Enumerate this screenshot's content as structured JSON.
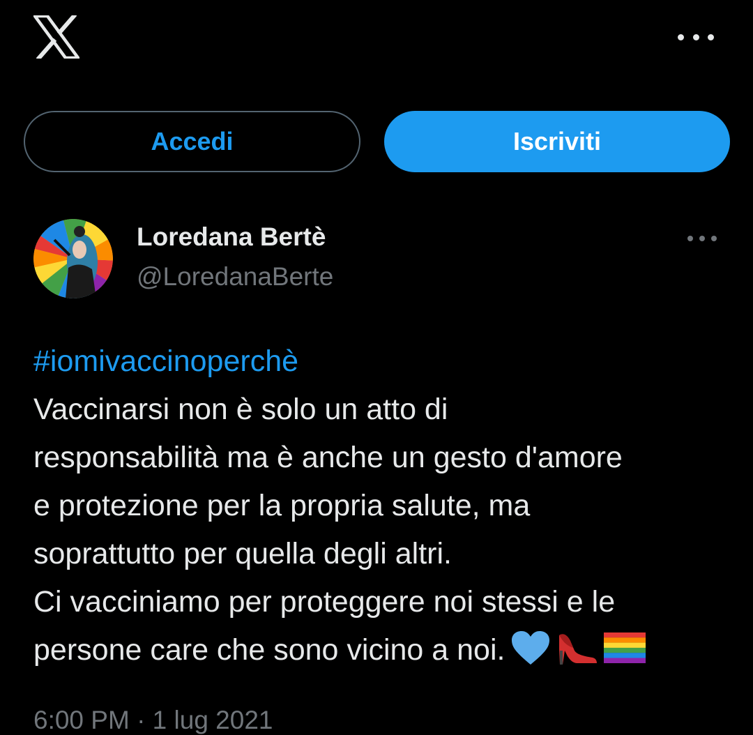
{
  "header": {
    "logo_icon": "x-logo-icon",
    "more_icon": "more-horizontal-icon"
  },
  "auth": {
    "login_label": "Accedi",
    "signup_label": "Iscriviti"
  },
  "tweet": {
    "author": {
      "display_name": "Loredana Bertè",
      "handle": "@LoredanaBerte"
    },
    "hashtag": "#iomivaccinoperchè",
    "lines": [
      "Vaccinarsi non è solo un atto di",
      "responsabilità ma è anche un gesto d'amore",
      "e protezione per la propria salute, ma",
      "soprattutto per quella degli altri.",
      "Ci vacciniamo per proteggere noi stessi e le",
      "persone care che sono vicino a noi."
    ],
    "emoji": [
      "blue-heart-icon",
      "high-heel-icon",
      "rainbow-flag-icon"
    ],
    "timestamp": "6:00 PM · 1 lug 2021"
  },
  "colors": {
    "background": "#000000",
    "accent": "#1d9bf0",
    "text_primary": "#e7e9ea",
    "text_secondary": "#71767b",
    "border": "#536471"
  }
}
